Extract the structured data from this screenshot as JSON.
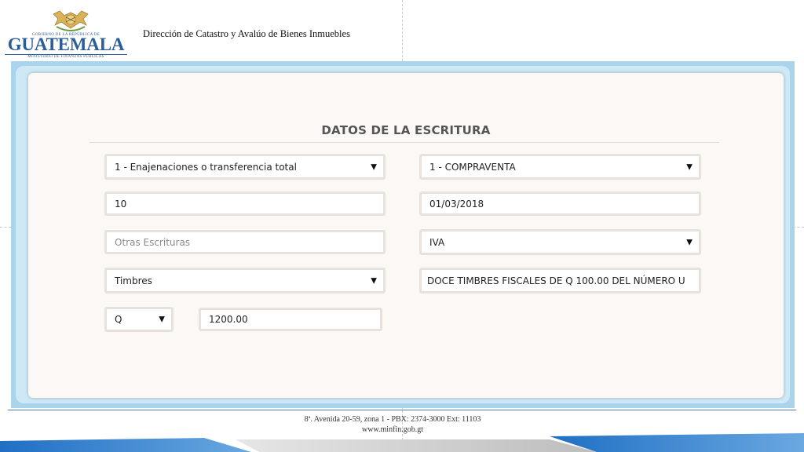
{
  "header": {
    "logo_small": "GOBIERNO DE LA REPÚBLICA DE",
    "logo_main": "GUATEMALA",
    "logo_sub": "MINISTERIO DE FINANZAS PÚBLICAS",
    "title": "Dirección de Catastro y Avalúo de Bienes Inmuebles"
  },
  "form": {
    "title": "DATOS DE LA ESCRITURA",
    "tipo_operacion": "1 - Enajenaciones o transferencia total",
    "subtipo": "1 - COMPRAVENTA",
    "numero": "10",
    "fecha": "01/03/2018",
    "otras_placeholder": "Otras Escrituras",
    "impuesto": "IVA",
    "pago": "Timbres",
    "descripcion_timbres": "DOCE TIMBRES FISCALES DE Q 100.00 DEL NÚMERO U",
    "moneda": "Q",
    "monto": "1200.00"
  },
  "footer": {
    "address": "8ª. Avenida 20-59, zona 1 -  PBX: 2374-3000  Ext: 11103",
    "website": "www.minfin.gob.gt"
  },
  "colors": {
    "brand_blue": "#2d5d95",
    "frame_blue": "#aad4ec",
    "card_bg": "#fcf8f5"
  }
}
